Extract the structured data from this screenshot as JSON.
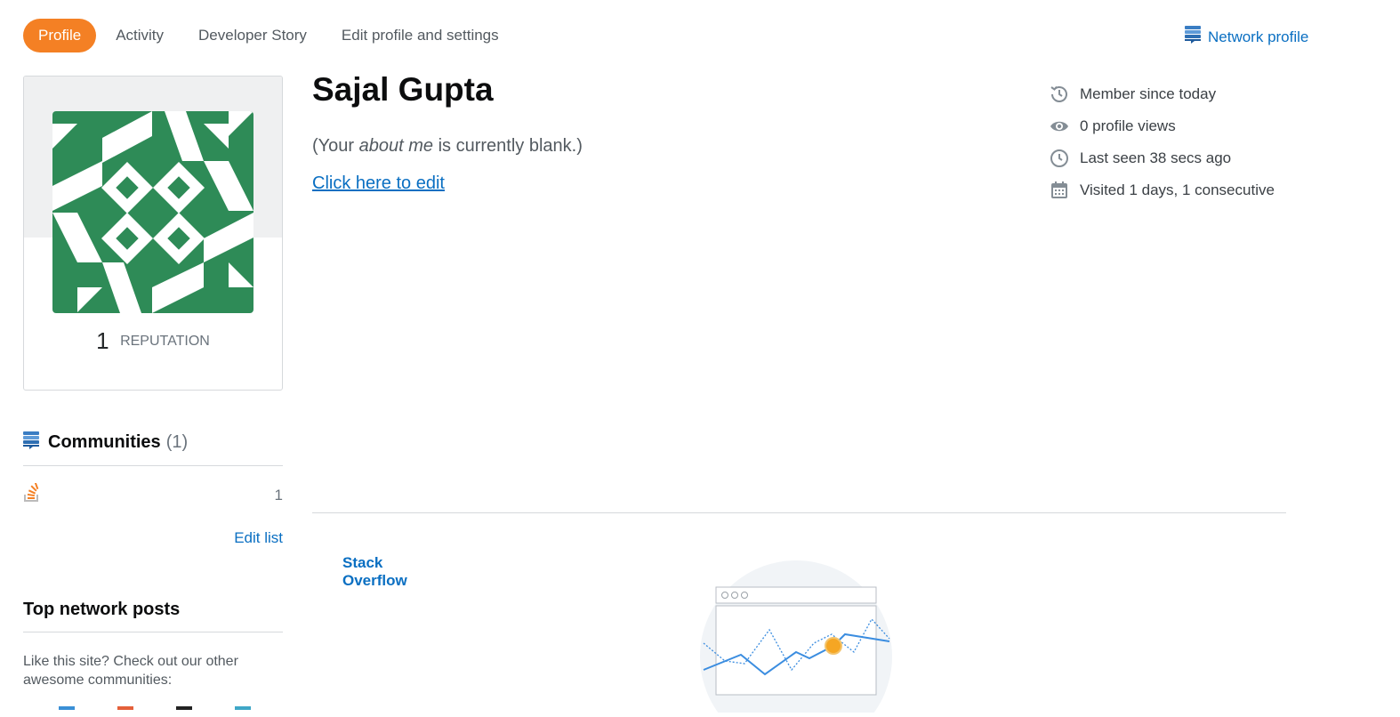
{
  "tabs": [
    {
      "label": "Profile",
      "active": true
    },
    {
      "label": "Activity",
      "active": false
    },
    {
      "label": "Developer Story",
      "active": false
    },
    {
      "label": "Edit profile and settings",
      "active": false
    }
  ],
  "network_profile": {
    "label": "Network profile",
    "icon": "stack-exchange-icon"
  },
  "profile": {
    "avatar": {
      "icon": "identicon-avatar",
      "color": "#2e8b57"
    },
    "reputation_value": "1",
    "reputation_label": "REPUTATION",
    "name": "Sajal Gupta",
    "about_prefix": "(Your ",
    "about_emph": "about me",
    "about_suffix": " is currently blank.)",
    "edit_link": "Click here to edit"
  },
  "stats": [
    {
      "icon": "history-icon",
      "text": "Member since today"
    },
    {
      "icon": "eye-icon",
      "text": "0 profile views"
    },
    {
      "icon": "clock-icon",
      "text": "Last seen 38 secs ago"
    },
    {
      "icon": "calendar-icon",
      "text": "Visited 1 days, 1 consecutive"
    }
  ],
  "communities": {
    "title": "Communities",
    "count": "(1)",
    "items": [
      {
        "name": "Stack Overflow",
        "reputation": "1",
        "icon": "stack-overflow-icon"
      }
    ],
    "edit_label": "Edit list"
  },
  "top_posts": {
    "title": "Top network posts",
    "prompt": "Like this site? Check out our other awesome communities:"
  },
  "colors": {
    "accent": "#f48024",
    "link": "#0a6fc2",
    "avatar_bg": "#2e8b57"
  }
}
